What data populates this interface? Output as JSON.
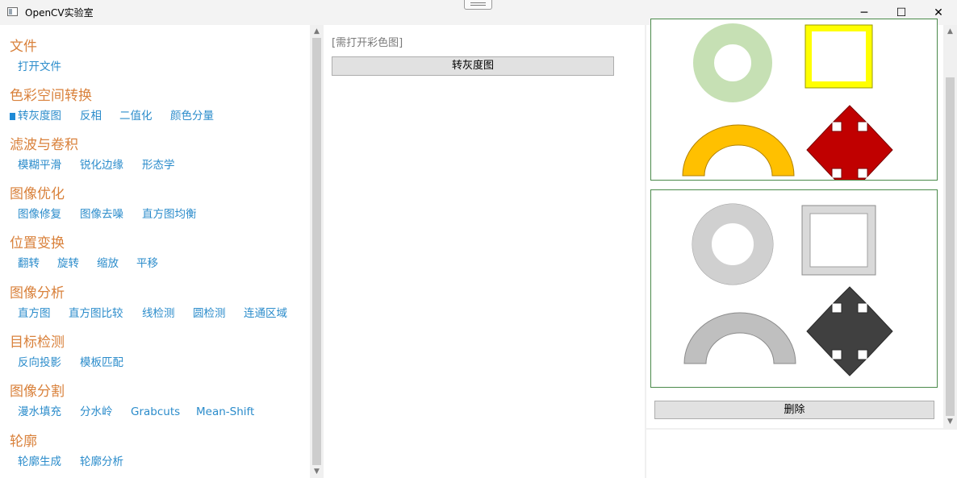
{
  "window": {
    "title": "OpenCV实验室",
    "controls": {
      "minimize": "─",
      "maximize": "☐",
      "close": "✕"
    }
  },
  "sidebar": {
    "selected": "转灰度图",
    "sections": [
      {
        "title": "文件",
        "items": [
          "打开文件"
        ]
      },
      {
        "title": "色彩空间转换",
        "items": [
          "转灰度图",
          "反相",
          "二值化",
          "颜色分量"
        ]
      },
      {
        "title": "滤波与卷积",
        "items": [
          "模糊平滑",
          "锐化边缘",
          "形态学"
        ]
      },
      {
        "title": "图像优化",
        "items": [
          "图像修复",
          "图像去噪",
          "直方图均衡"
        ]
      },
      {
        "title": "位置变换",
        "items": [
          "翻转",
          "旋转",
          "缩放",
          "平移"
        ]
      },
      {
        "title": "图像分析",
        "items": [
          "直方图",
          "直方图比较",
          "线检测",
          "圆检测",
          "连通区域"
        ]
      },
      {
        "title": "目标检测",
        "items": [
          "反向投影",
          "模板匹配"
        ]
      },
      {
        "title": "图像分割",
        "items": [
          "漫水填充",
          "分水岭",
          "Grabcuts",
          "Mean-Shift"
        ]
      },
      {
        "title": "轮廓",
        "items": [
          "轮廓生成",
          "轮廓分析"
        ]
      }
    ]
  },
  "main": {
    "hint": "[需打开彩色图]",
    "convert_button": "转灰度图"
  },
  "preview": {
    "delete_button": "删除"
  },
  "colors": {
    "section_title": "#d9813b",
    "link": "#2b8ccb",
    "ring": "#c6e0b4",
    "square": "#ffff00",
    "arch": "#ffc000",
    "arrow": "#c00000",
    "gray_ring": "#d0d0d0",
    "gray_arch": "#bfbfbf",
    "gray_arrow": "#404040"
  }
}
